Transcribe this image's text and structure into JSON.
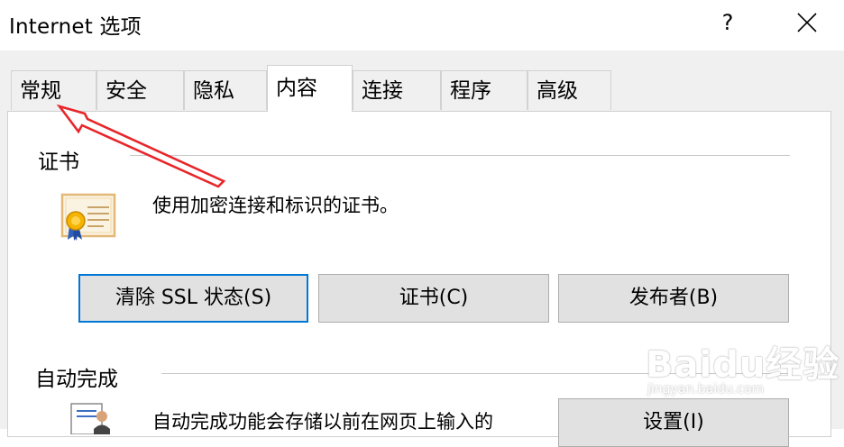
{
  "window": {
    "title": "Internet 选项",
    "help_label": "?"
  },
  "tabs": [
    {
      "label": "常规"
    },
    {
      "label": "安全"
    },
    {
      "label": "隐私"
    },
    {
      "label": "内容"
    },
    {
      "label": "连接"
    },
    {
      "label": "程序"
    },
    {
      "label": "高级"
    }
  ],
  "active_tab": "内容",
  "certificates": {
    "section_label": "证书",
    "description": "使用加密连接和标识的证书。",
    "buttons": {
      "clear_ssl": "清除 SSL 状态(S)",
      "certificates": "证书(C)",
      "publishers": "发布者(B)"
    }
  },
  "autocomplete": {
    "section_label": "自动完成",
    "description": "自动完成功能会存储以前在网页上输入的",
    "settings_button": "设置(I)"
  },
  "watermark": {
    "text": "Baidu经验",
    "subtext": "jingyan.baidu.com"
  },
  "colors": {
    "focus_border": "#0078d7",
    "annotation_arrow": "#e8262a",
    "panel_background": "#f0f0f0"
  }
}
